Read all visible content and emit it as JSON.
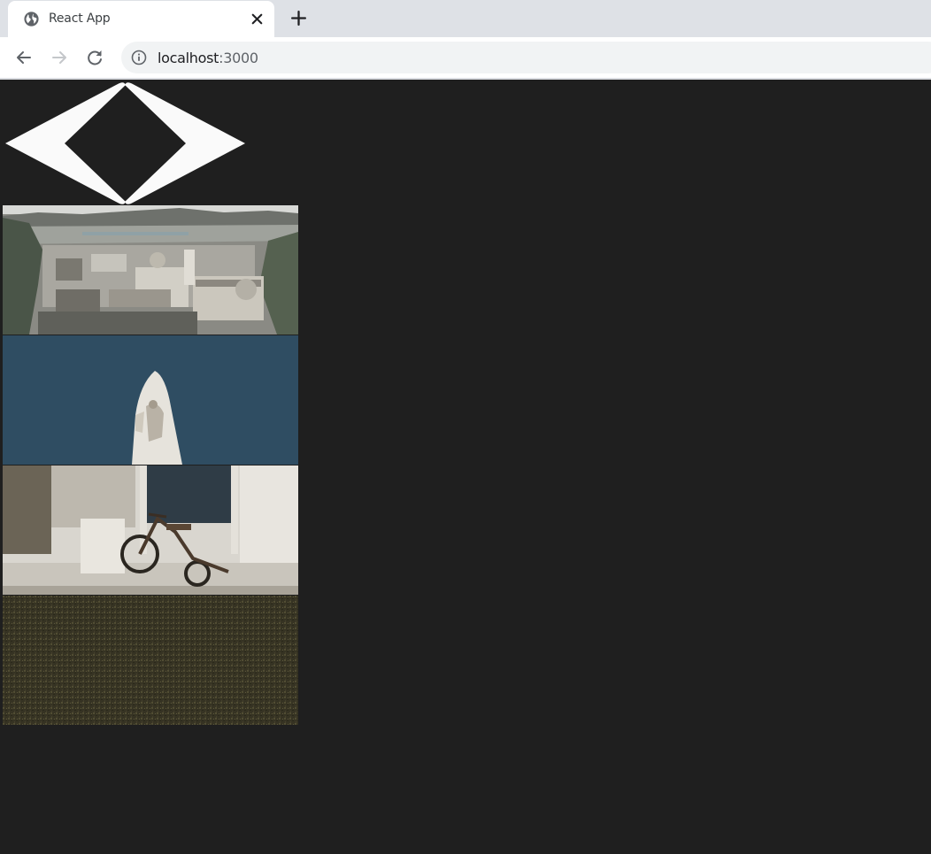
{
  "browser": {
    "tab_title": "React App",
    "url_host": "localhost",
    "url_port": ":3000",
    "icons": [
      "globe-icon",
      "close-icon",
      "plus-icon",
      "back-arrow-icon",
      "forward-arrow-icon",
      "reload-icon",
      "info-icon"
    ]
  },
  "page": {
    "background_color": "#1f1f1f",
    "logo_icon": "diamond-chevrons-logo",
    "gallery": [
      {
        "subject": "aerial city view with baroque domes"
      },
      {
        "subject": "white statue against blue sky"
      },
      {
        "subject": "vintage tricycle beside a building"
      },
      {
        "subject": "dark olive textured surface"
      }
    ]
  }
}
